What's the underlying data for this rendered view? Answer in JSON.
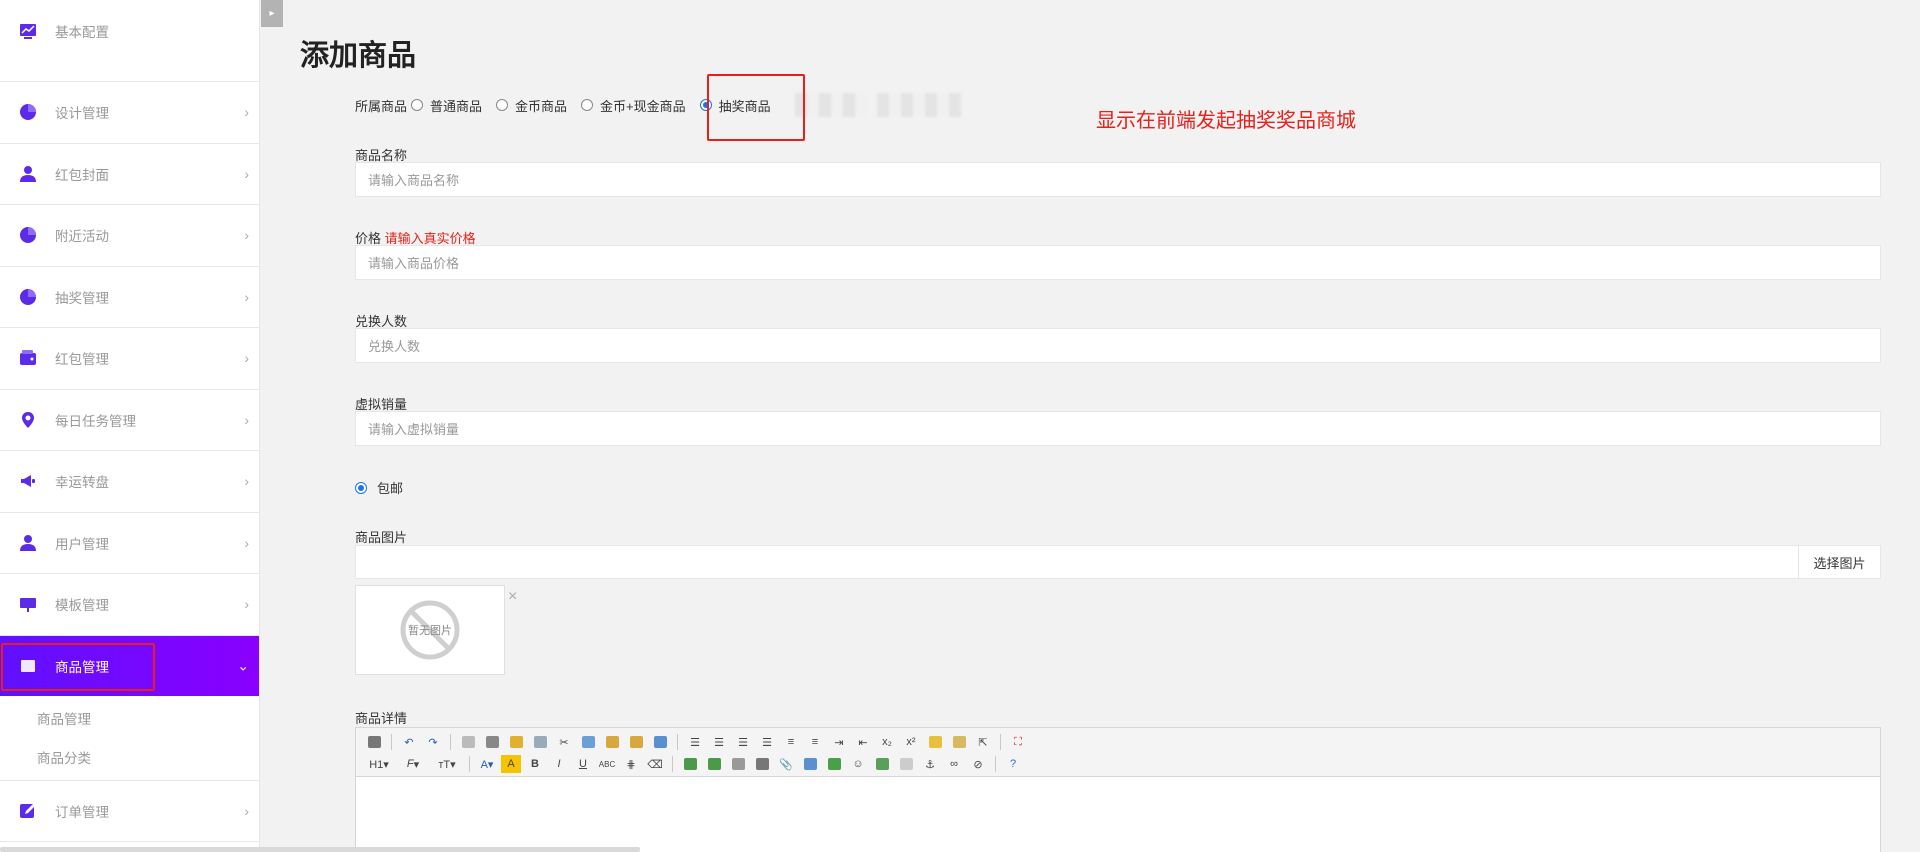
{
  "sidebar": {
    "items": [
      {
        "label": "基本配置",
        "icon": "chart-icon"
      },
      {
        "label": "设计管理",
        "icon": "pie-chart-icon"
      },
      {
        "label": "红包封面",
        "icon": "user-icon"
      },
      {
        "label": "附近活动",
        "icon": "pie-chart-icon"
      },
      {
        "label": "抽奖管理",
        "icon": "pie-chart-icon"
      },
      {
        "label": "红包管理",
        "icon": "wallet-icon"
      },
      {
        "label": "每日任务管理",
        "icon": "location-icon"
      },
      {
        "label": "幸运转盘",
        "icon": "megaphone-icon"
      },
      {
        "label": "用户管理",
        "icon": "user-icon"
      },
      {
        "label": "模板管理",
        "icon": "board-icon"
      }
    ],
    "active": {
      "label": "商品管理"
    },
    "sub_items": [
      "商品管理",
      "商品分类"
    ],
    "after": {
      "label": "订单管理"
    },
    "chevron": "›",
    "chevron_open": "⌄"
  },
  "toggle_glyph": "▸",
  "page": {
    "title": "添加商品"
  },
  "product_type": {
    "label": "所属商品",
    "options": [
      "普通商品",
      "金币商品",
      "金币+现金商品",
      "抽奖商品"
    ],
    "selected_index": 3
  },
  "annotation": "显示在前端发起抽奖奖品商城",
  "fields": {
    "name": {
      "label": "商品名称",
      "placeholder": "请输入商品名称"
    },
    "price": {
      "label": "价格",
      "warning": "请输入真实价格",
      "placeholder": "请输入商品价格"
    },
    "exchange": {
      "label": "兑换人数",
      "placeholder": "兑换人数"
    },
    "virtual_sales": {
      "label": "虚拟销量",
      "placeholder": "请输入虚拟销量"
    }
  },
  "shipping": {
    "label": "包邮",
    "checked": true
  },
  "image": {
    "label": "商品图片",
    "button": "选择图片",
    "empty_text": "暂无图片",
    "close": "×"
  },
  "detail": {
    "label": "商品详情"
  },
  "colors": {
    "accent": "#6010ff",
    "highlight": "#e8201c",
    "radio": "#1a73e8"
  }
}
